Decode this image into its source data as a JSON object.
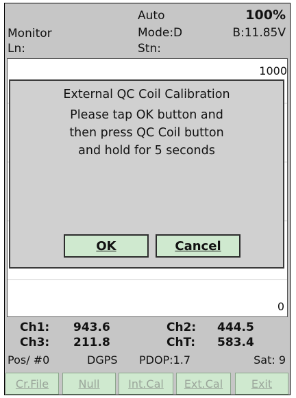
{
  "header": {
    "app_label": "Monitor",
    "ln_label": "Ln:",
    "auto_label": "Auto",
    "mode_label": "Mode:D",
    "stn_label": "Stn:",
    "battery_percent": "100%",
    "battery_voltage": "B:11.85V"
  },
  "plot": {
    "y_max_label": "1000",
    "y_min_label": "0"
  },
  "dialog": {
    "title": "External QC Coil Calibration",
    "line1": "Please tap OK button and",
    "line2": "then press QC Coil button",
    "line3": "and hold for 5 seconds",
    "ok_label": "OK",
    "cancel_label": "Cancel"
  },
  "readouts": {
    "ch1_label": "Ch1:",
    "ch1_value": "943.6",
    "ch2_label": "Ch2:",
    "ch2_value": "444.5",
    "ch3_label": "Ch3:",
    "ch3_value": "211.8",
    "cht_label": "ChT:",
    "cht_value": "583.4"
  },
  "status": {
    "pos": "Pos/ #0",
    "fix": "DGPS",
    "pdop": "PDOP:1.7",
    "sat": "Sat: 9"
  },
  "buttons": {
    "cr_file": "Cr.File",
    "null": "Null",
    "int_cal": "Int.Cal",
    "ext_cal": "Ext.Cal",
    "exit": "Exit"
  }
}
